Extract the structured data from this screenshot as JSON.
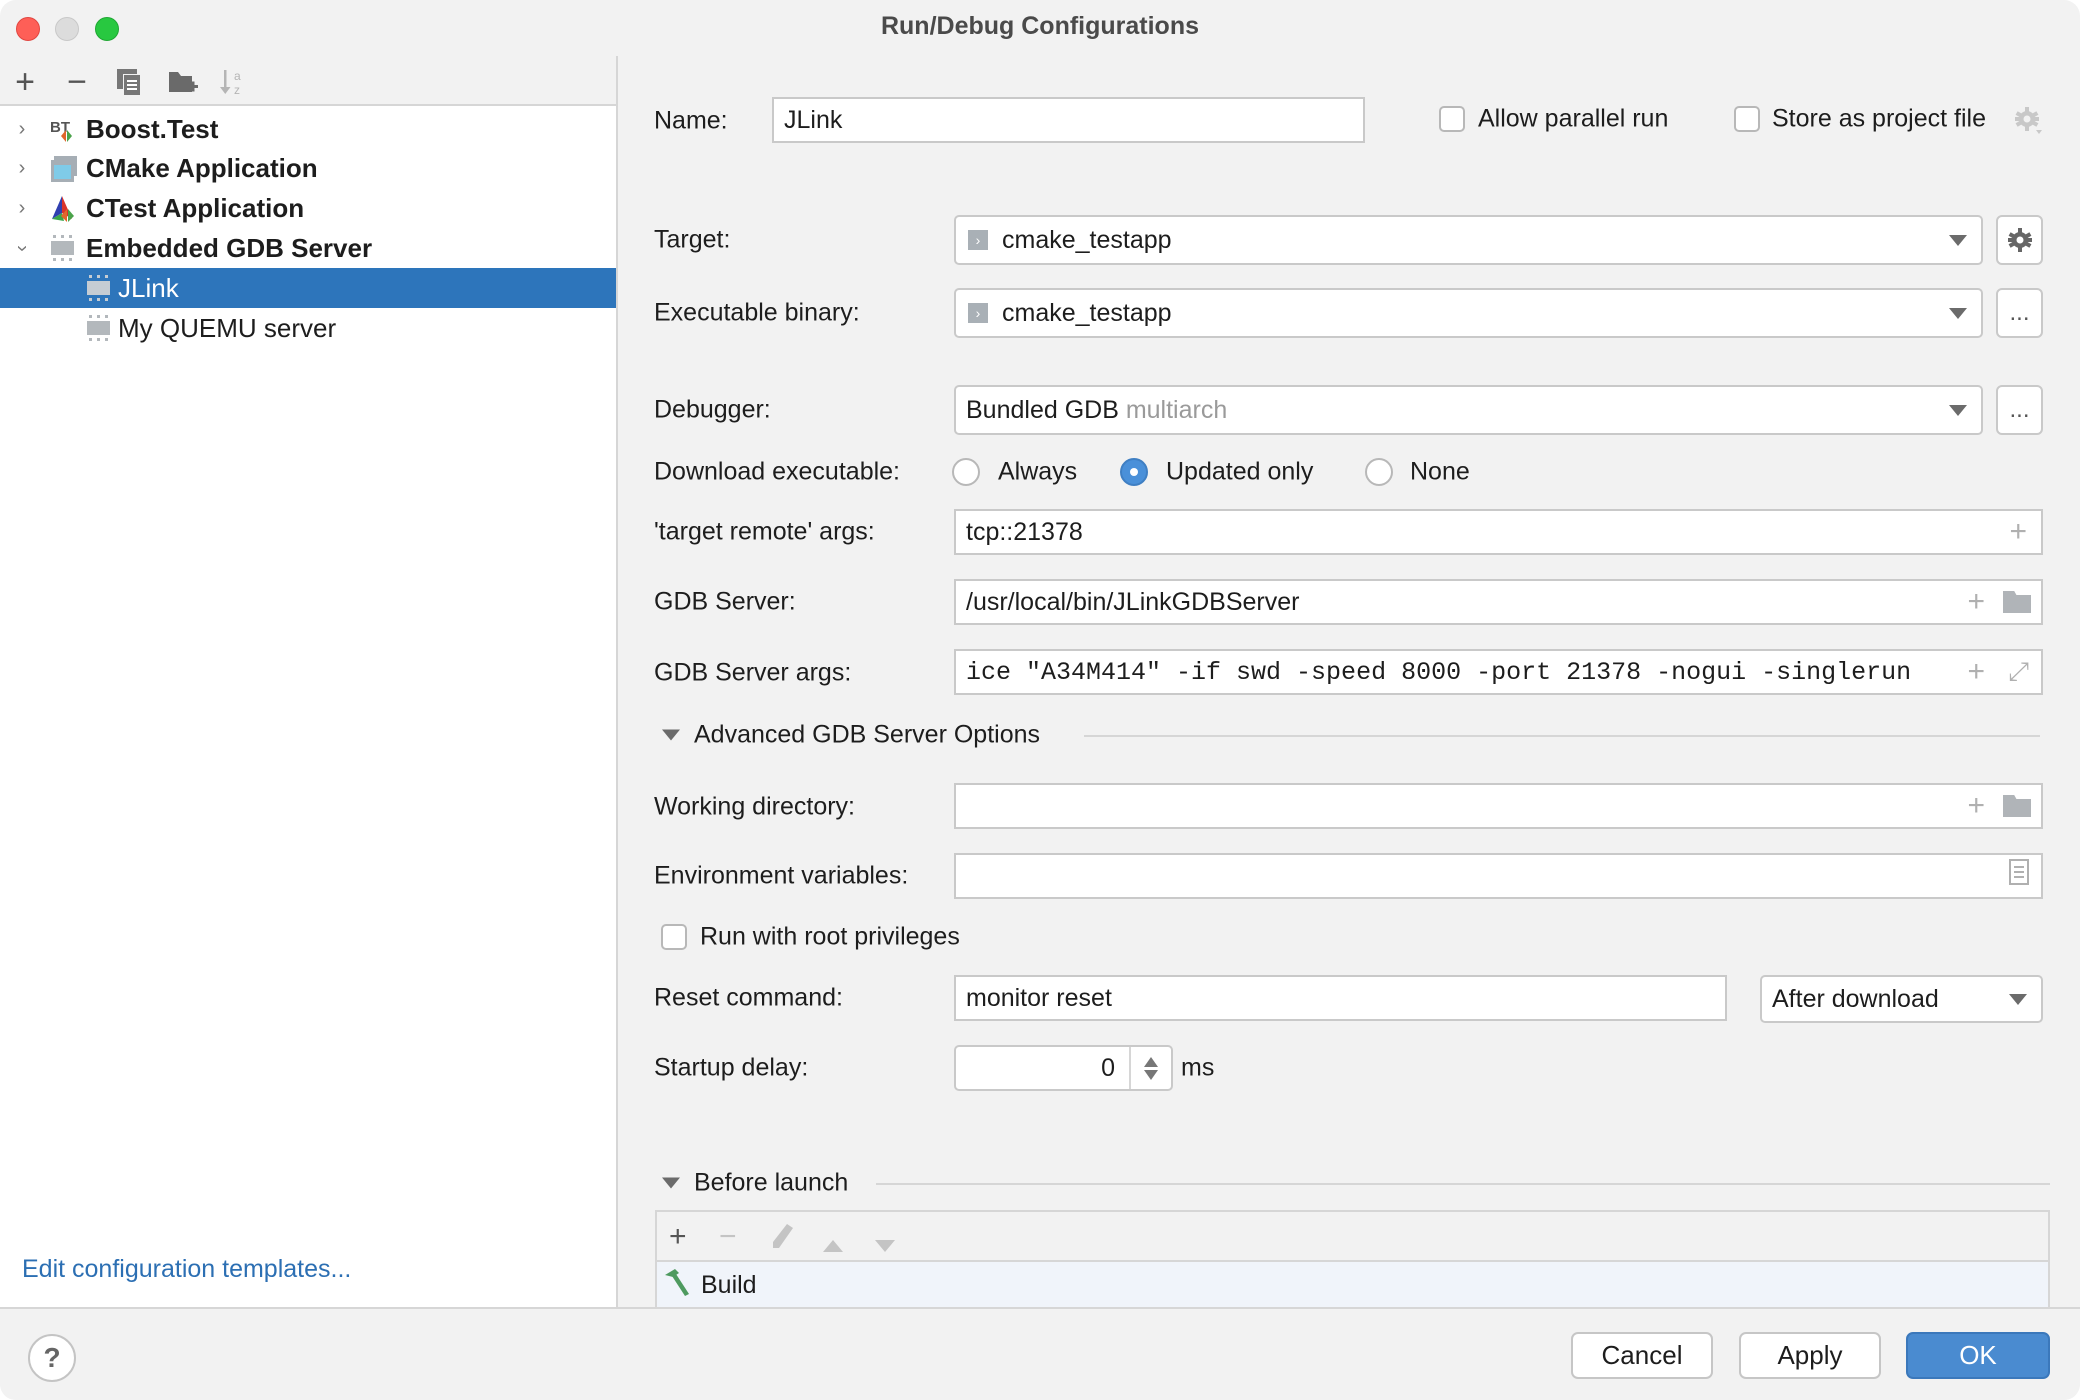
{
  "window": {
    "title": "Run/Debug Configurations"
  },
  "sidebar": {
    "toolbar": [
      {
        "name": "add-icon",
        "glyph": "+"
      },
      {
        "name": "remove-icon",
        "glyph": "−"
      },
      {
        "name": "copy-icon",
        "glyph": "⧉"
      },
      {
        "name": "new-folder-icon",
        "glyph": "▰"
      },
      {
        "name": "sort-icon",
        "glyph": "↓"
      }
    ],
    "tree": [
      {
        "label": "Boost.Test",
        "expanded": false,
        "icon": "boost-test-icon"
      },
      {
        "label": "CMake Application",
        "expanded": false,
        "icon": "cmake-app-icon"
      },
      {
        "label": "CTest Application",
        "expanded": false,
        "icon": "ctest-icon"
      },
      {
        "label": "Embedded GDB Server",
        "expanded": true,
        "icon": "chip-icon"
      },
      {
        "label": "JLink",
        "selected": true,
        "icon": "chip-icon"
      },
      {
        "label": "My QUEMU server",
        "icon": "chip-icon"
      }
    ],
    "edit_templates_link": "Edit configuration templates..."
  },
  "form": {
    "name_label": "Name:",
    "name_value": "JLink",
    "allow_parallel_label": "Allow parallel run",
    "allow_parallel_checked": false,
    "store_project_label": "Store as project file",
    "store_project_checked": false,
    "target_label": "Target:",
    "target_value": "cmake_testapp",
    "exec_label": "Executable binary:",
    "exec_value": "cmake_testapp",
    "ellipsis": "...",
    "debugger_label": "Debugger:",
    "debugger_value": "Bundled GDB",
    "debugger_hint": "multiarch",
    "download_label": "Download executable:",
    "download_options": [
      "Always",
      "Updated only",
      "None"
    ],
    "download_selected": "Updated only",
    "target_remote_label": "'target remote' args:",
    "target_remote_value": "tcp::21378",
    "gdb_server_label": "GDB Server:",
    "gdb_server_value": "/usr/local/bin/JLinkGDBServer",
    "gdb_args_label": "GDB Server args:",
    "gdb_args_value": "ice \"A34M414\" -if swd -speed 8000 -port 21378 -nogui -singlerun",
    "advanced_section": "Advanced GDB Server Options",
    "working_dir_label": "Working directory:",
    "working_dir_value": "",
    "env_vars_label": "Environment variables:",
    "env_vars_value": "",
    "root_priv_label": "Run with root privileges",
    "root_priv_checked": false,
    "reset_cmd_label": "Reset command:",
    "reset_cmd_value": "monitor reset",
    "reset_timing_value": "After download",
    "startup_delay_label": "Startup delay:",
    "startup_delay_value": "0",
    "startup_delay_unit": "ms"
  },
  "before_launch": {
    "section": "Before launch",
    "tasks": [
      "Build"
    ]
  },
  "footer": {
    "help": "?",
    "cancel": "Cancel",
    "apply": "Apply",
    "ok": "OK"
  },
  "colors": {
    "selection": "#2d75bb",
    "link": "#2c6fb3",
    "primary_button": "#4a8bd0",
    "radio_selected": "#4a90d9"
  }
}
